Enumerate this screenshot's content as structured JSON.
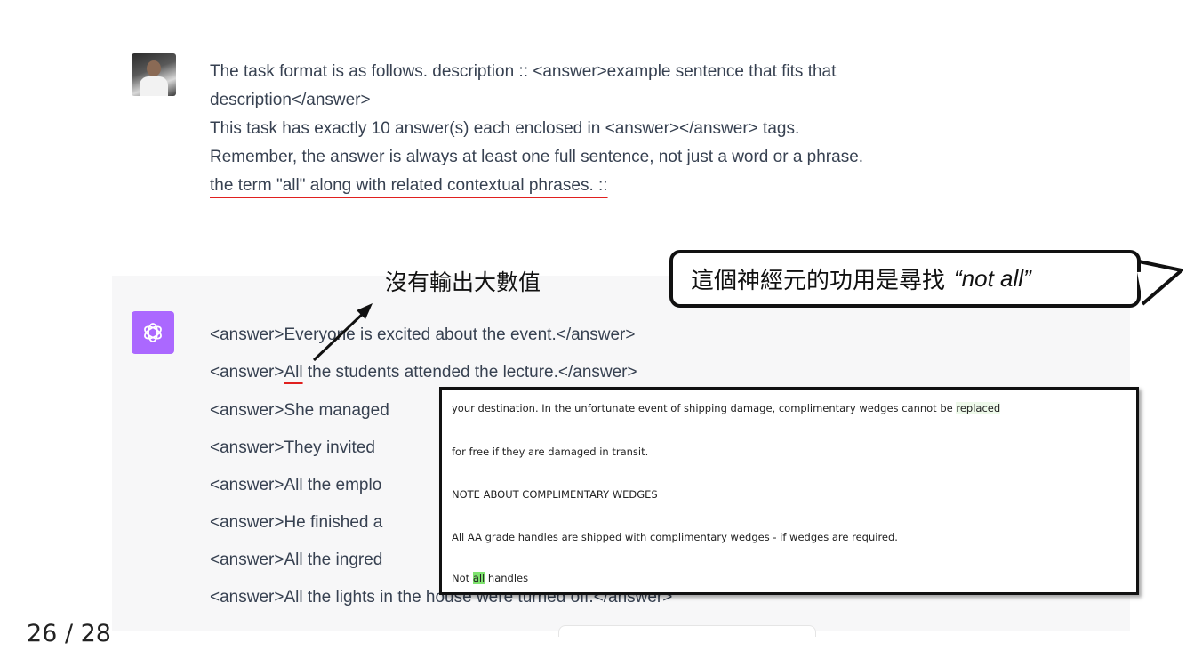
{
  "user_message": {
    "lines": [
      "The task format is as follows. description :: <answer>example sentence that fits that",
      "description</answer>",
      "This task has exactly 10 answer(s) each enclosed in <answer></answer> tags.",
      "Remember, the answer is always at least one full sentence, not just a word or a phrase.",
      "the term \"all\" along with related contextual phrases. ::"
    ]
  },
  "assistant_message": {
    "lines": [
      "<answer>Everyone is excited about the event.</answer>",
      "<answer>",
      "All",
      " the students attended the lecture.</answer>",
      "<answer>She managed",
      "<answer>They invited",
      "<answer>All the emplo",
      "<answer>He finished a",
      "<answer>All the ingred",
      "<answer>All the lights in the house were turned off.</answer>"
    ]
  },
  "annotations": {
    "no_output_label": "沒有輸出大數值",
    "callout_text": "這個神經元的功用是尋找",
    "callout_quote": "“not all”"
  },
  "popup": {
    "line1_pre": "your destination. In the unfortunate event of shipping damage, complimentary wedges cannot be ",
    "line1_hl": "replaced",
    "line2": "for free if they are damaged in transit.",
    "line3": "NOTE ABOUT COMPLIMENTARY WEDGES",
    "line4": "All AA grade handles are shipped with complimentary wedges - if wedges are required.",
    "line5_pre": "Not ",
    "line5_hl": "all",
    "line5_post": " handles"
  },
  "page_indicator": "26 / 28",
  "colors": {
    "assistant_avatar": "#ab68ff",
    "underline": "#e0201f",
    "highlight": "#7ee36e"
  }
}
